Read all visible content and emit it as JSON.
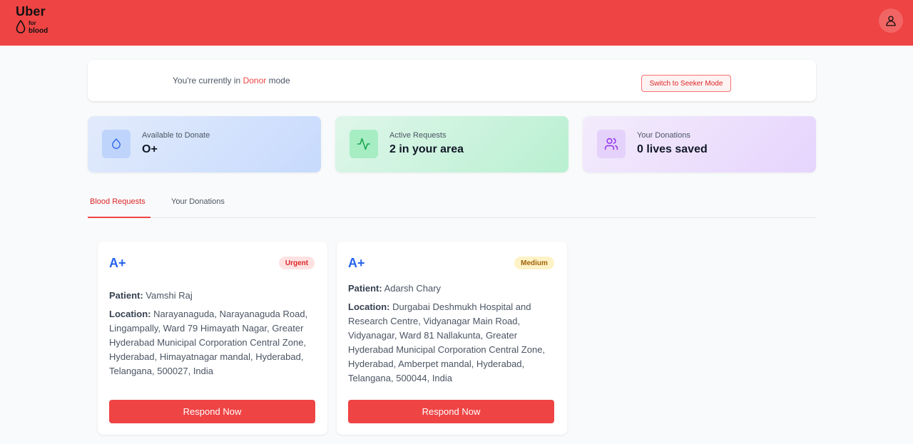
{
  "header": {
    "logo": {
      "line1": "Uber",
      "line2": "for",
      "line3": "blood"
    },
    "brand_color": "#ef4444",
    "profile_icon": "user-icon"
  },
  "mode_banner": {
    "prefix": "You're currently in ",
    "mode": "Donor",
    "suffix": " mode",
    "switch_label": "Switch to Seeker Mode"
  },
  "stats": [
    {
      "label": "Available to Donate",
      "value": "O+",
      "icon": "droplet-icon",
      "color": "#2563eb"
    },
    {
      "label": "Active Requests",
      "value": "2 in your area",
      "icon": "activity-icon",
      "color": "#16a34a"
    },
    {
      "label": "Your Donations",
      "value": "0 lives saved",
      "icon": "users-icon",
      "color": "#9333ea"
    }
  ],
  "tabs": [
    {
      "label": "Blood Requests",
      "active": true
    },
    {
      "label": "Your Donations",
      "active": false
    }
  ],
  "requests": [
    {
      "blood_type": "A+",
      "urgency": "Urgent",
      "patient_label": "Patient:",
      "patient": " Vamshi Raj",
      "location_label": "Location:",
      "location": " Narayanaguda, Narayanaguda Road, Lingampally, Ward 79 Himayath Nagar, Greater Hyderabad Municipal Corporation Central Zone, Hyderabad, Himayatnagar mandal, Hyderabad, Telangana, 500027, India",
      "button": "Respond Now"
    },
    {
      "blood_type": "A+",
      "urgency": "Medium",
      "patient_label": "Patient:",
      "patient": " Adarsh Chary",
      "location_label": "Location:",
      "location": " Durgabai Deshmukh Hospital and Research Centre, Vidyanagar Main Road, Vidyanagar, Ward 81 Nallakunta, Greater Hyderabad Municipal Corporation Central Zone, Hyderabad, Amberpet mandal, Hyderabad, Telangana, 500044, India",
      "button": "Respond Now"
    }
  ]
}
